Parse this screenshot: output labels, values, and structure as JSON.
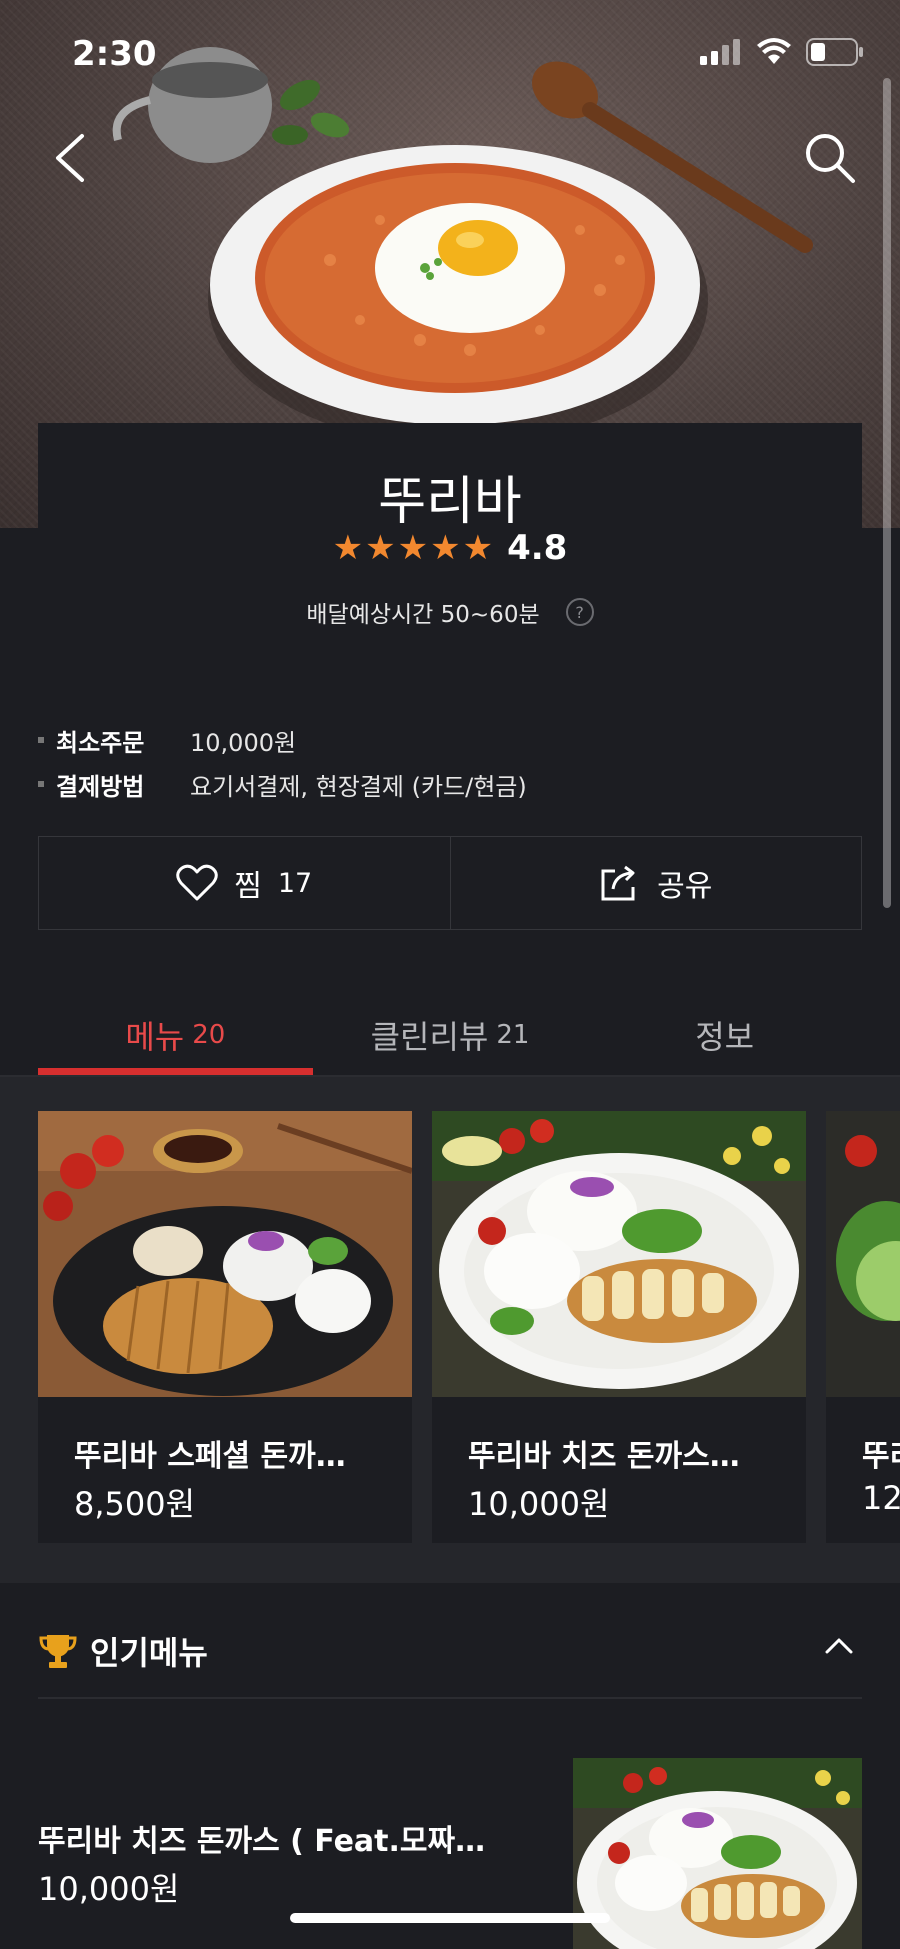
{
  "status": {
    "time": "2:30"
  },
  "store": {
    "name": "뚜리바",
    "rating": "4.8",
    "stars": 5,
    "delivery_label": "배달예상시간 50~60분",
    "help": "?"
  },
  "info": [
    {
      "label": "최소주문",
      "value": "10,000원"
    },
    {
      "label": "결제방법",
      "value": "요기서결제, 현장결제 (카드/현금)"
    }
  ],
  "actions": {
    "like_label": "찜",
    "like_count": "17",
    "share_label": "공유"
  },
  "tabs": [
    {
      "label": "메뉴",
      "count": "20",
      "active": true
    },
    {
      "label": "클린리뷰",
      "count": "21",
      "active": false
    },
    {
      "label": "정보",
      "count": "",
      "active": false
    }
  ],
  "menu_items": [
    {
      "name": "뚜리바 스페셜 돈까…",
      "price": "8,500원"
    },
    {
      "name": "뚜리바 치즈 돈까스…",
      "price": "10,000원"
    },
    {
      "name": "뚜리",
      "price": "12"
    }
  ],
  "popular": {
    "title": "인기메뉴",
    "item": {
      "name": "뚜리바 치즈 돈까스 ( Feat.모짜…",
      "price": "10,000원"
    }
  },
  "colors": {
    "accent": "#d72f2f",
    "star": "#f2882f",
    "background": "#1c1d22"
  }
}
